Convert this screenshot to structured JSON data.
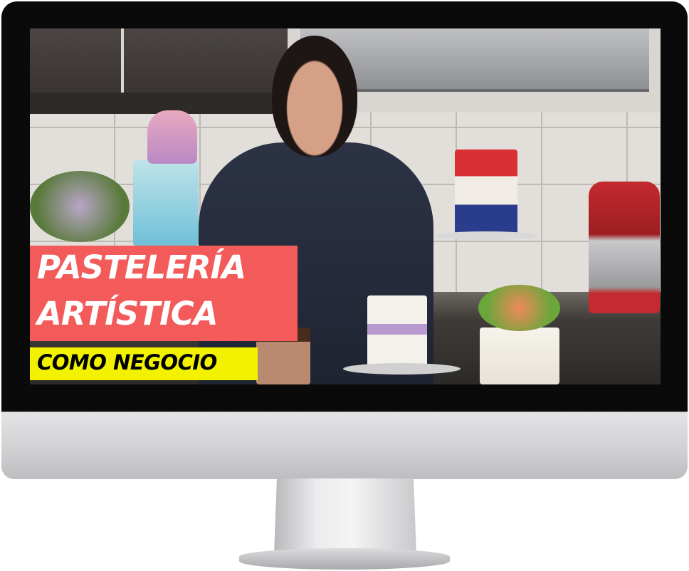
{
  "thumbnail": {
    "title_line1": "PASTELERÍA",
    "title_line2": "ARTÍSTICA",
    "subtitle": "COMO NEGOCIO",
    "colors": {
      "title_bg": "#f35b5b",
      "subtitle_bg": "#f2f200",
      "title_text": "#ffffff",
      "subtitle_text": "#000000"
    }
  },
  "device": "imac-monitor"
}
